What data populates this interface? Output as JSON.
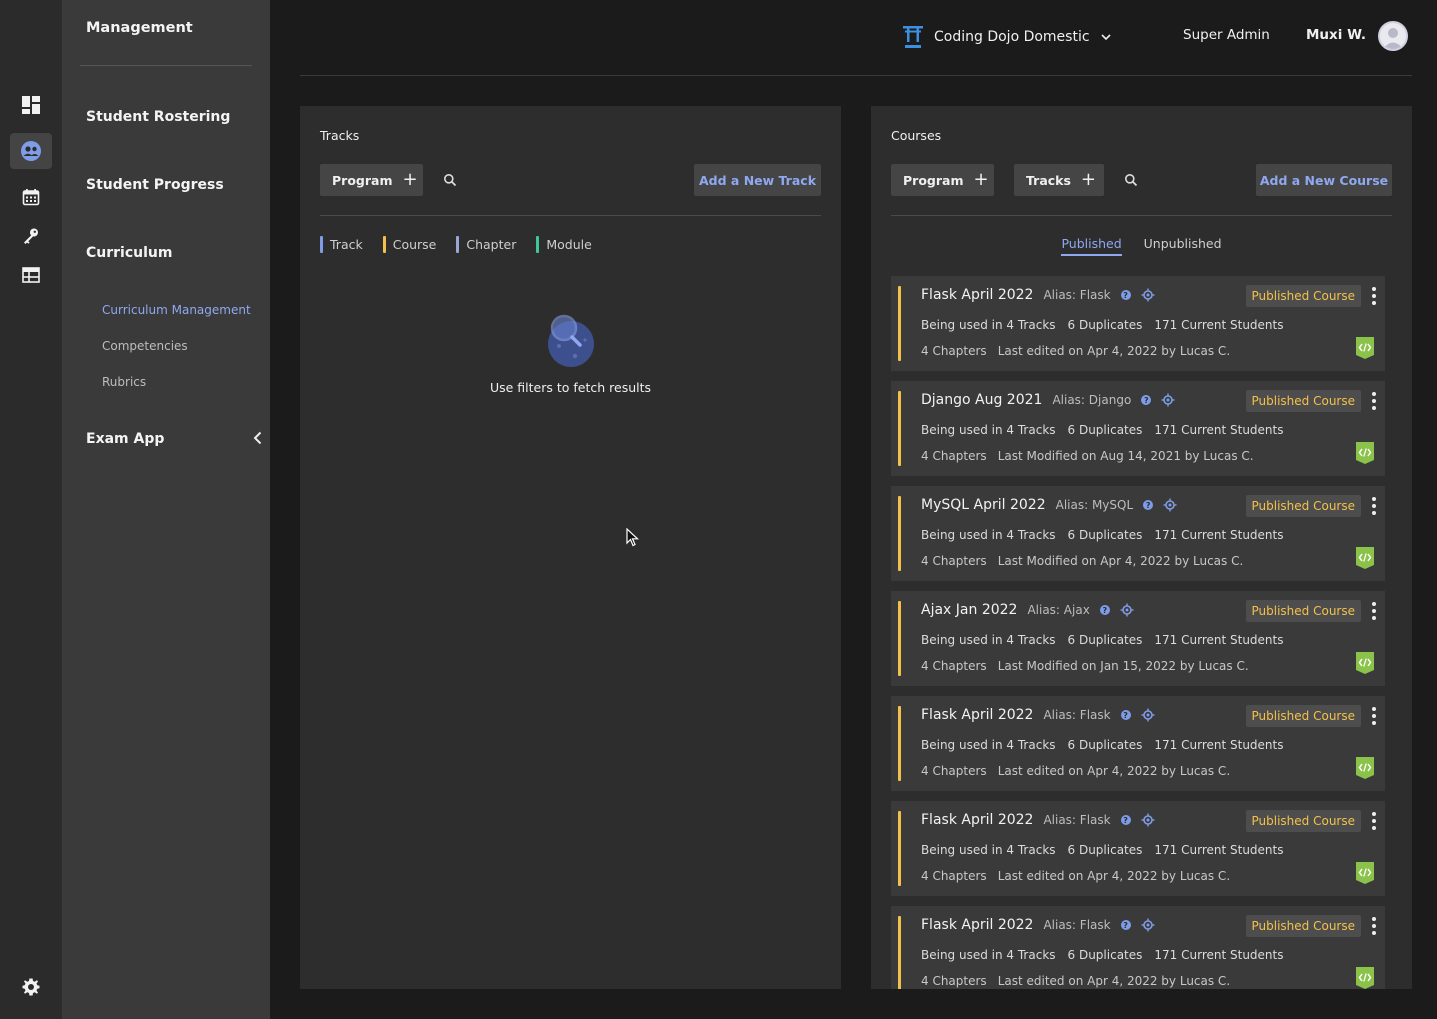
{
  "colors": {
    "accent": "#8fa8f0",
    "course": "#f3c14b",
    "track": "#7e9ce8",
    "chapter": "#9aa6d8",
    "module": "#3fc795",
    "code": "#8bc34a"
  },
  "rail": {
    "icons": [
      "dashboard-icon",
      "community-icon",
      "calendar-icon",
      "key-icon",
      "table-icon",
      "gear-icon"
    ]
  },
  "sidebar": {
    "title": "Management",
    "sections": [
      "Student Rostering",
      "Student Progress",
      "Curriculum"
    ],
    "curriculum_items": [
      "Curriculum Management",
      "Competencies",
      "Rubrics"
    ],
    "exam": "Exam App"
  },
  "header": {
    "org": "Coding Dojo Domestic",
    "role": "Super Admin",
    "user": "Muxi W."
  },
  "tracks": {
    "title": "Tracks",
    "program_filter": "Program",
    "add_label": "Add a New Track",
    "legend": [
      "Track",
      "Course",
      "Chapter",
      "Module"
    ],
    "empty_message": "Use filters to fetch results"
  },
  "courses": {
    "title": "Courses",
    "program_filter": "Program",
    "tracks_filter": "Tracks",
    "add_label": "Add a New Course",
    "tabs": [
      "Published",
      "Unpublished"
    ],
    "items": [
      {
        "title": "Flask April 2022",
        "alias": "Alias: Flask",
        "badge": "Published Course",
        "usage": "Being used in 4 Tracks",
        "duplicates": "6 Duplicates",
        "students": "171 Current Students",
        "chapters": "4 Chapters",
        "edited": "Last edited on Apr 4, 2022 by Lucas C."
      },
      {
        "title": "Django Aug 2021",
        "alias": "Alias: Django",
        "badge": "Published Course",
        "usage": "Being used in 4 Tracks",
        "duplicates": "6 Duplicates",
        "students": "171 Current Students",
        "chapters": "4 Chapters",
        "edited": "Last Modified on Aug 14, 2021 by Lucas C."
      },
      {
        "title": "MySQL April 2022",
        "alias": "Alias: MySQL",
        "badge": "Published Course",
        "usage": "Being used in 4 Tracks",
        "duplicates": "6 Duplicates",
        "students": "171 Current Students",
        "chapters": "4 Chapters",
        "edited": "Last Modified on Apr 4, 2022 by Lucas C."
      },
      {
        "title": "Ajax Jan 2022",
        "alias": "Alias: Ajax",
        "badge": "Published Course",
        "usage": "Being used in 4 Tracks",
        "duplicates": "6 Duplicates",
        "students": "171 Current Students",
        "chapters": "4 Chapters",
        "edited": "Last Modified on Jan 15, 2022 by Lucas C."
      },
      {
        "title": "Flask April 2022",
        "alias": "Alias: Flask",
        "badge": "Published Course",
        "usage": "Being used in 4 Tracks",
        "duplicates": "6 Duplicates",
        "students": "171 Current Students",
        "chapters": "4 Chapters",
        "edited": "Last edited on Apr 4, 2022 by Lucas C."
      },
      {
        "title": "Flask April 2022",
        "alias": "Alias: Flask",
        "badge": "Published Course",
        "usage": "Being used in 4 Tracks",
        "duplicates": "6 Duplicates",
        "students": "171 Current Students",
        "chapters": "4 Chapters",
        "edited": "Last edited on Apr 4, 2022 by Lucas C."
      },
      {
        "title": "Flask April 2022",
        "alias": "Alias: Flask",
        "badge": "Published Course",
        "usage": "Being used in 4 Tracks",
        "duplicates": "6 Duplicates",
        "students": "171 Current Students",
        "chapters": "4 Chapters",
        "edited": "Last edited on Apr 4, 2022 by Lucas C."
      }
    ]
  }
}
